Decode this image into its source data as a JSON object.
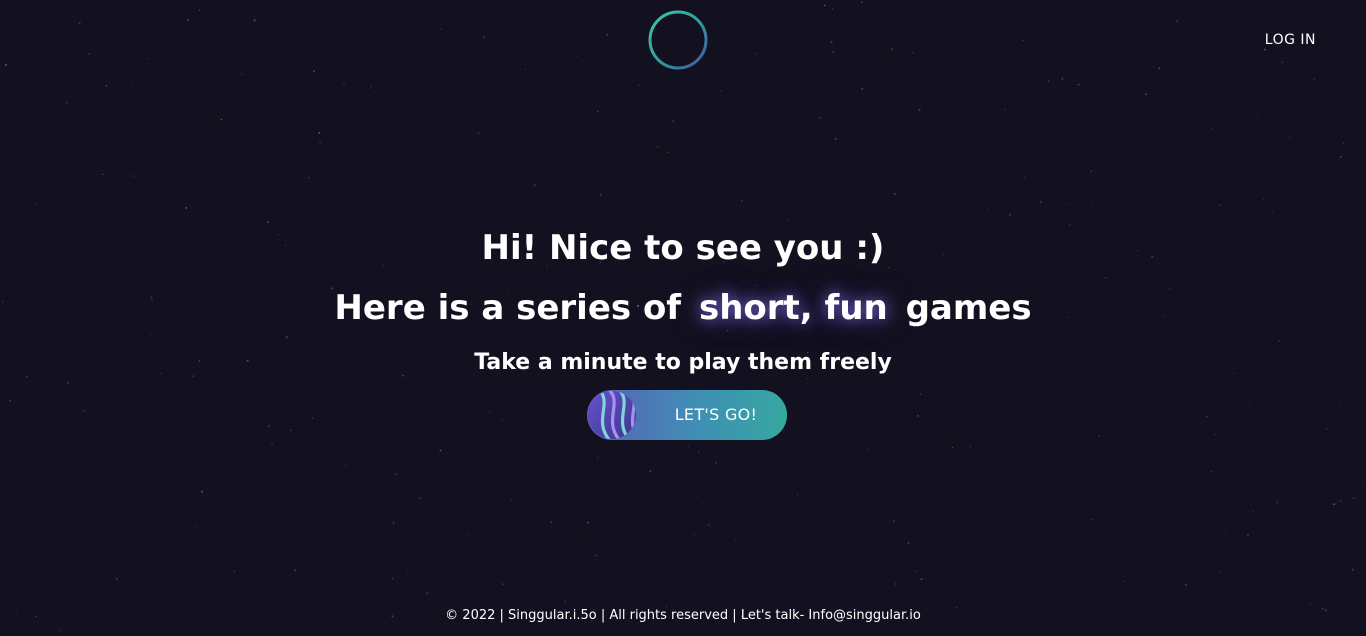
{
  "header": {
    "logo_icon": "ring-logo-icon",
    "login_label": "LOG IN"
  },
  "hero": {
    "line1": "Hi! Nice to see you :)",
    "line2_prefix": "Here is a series of",
    "line2_highlight": "short, fun",
    "line2_suffix": "games",
    "subtitle": "Take a minute to play them freely"
  },
  "cta": {
    "label": "LET'S GO!",
    "icon": "striped-orb-icon"
  },
  "footer": {
    "text": "© 2022 | Singgular.i.5o | All rights reserved | Let's talk- Info@singgular.io"
  },
  "colors": {
    "background": "#13111f",
    "accent_purple": "#5a5fb8",
    "accent_teal": "#35a89f",
    "text": "#ffffff"
  }
}
